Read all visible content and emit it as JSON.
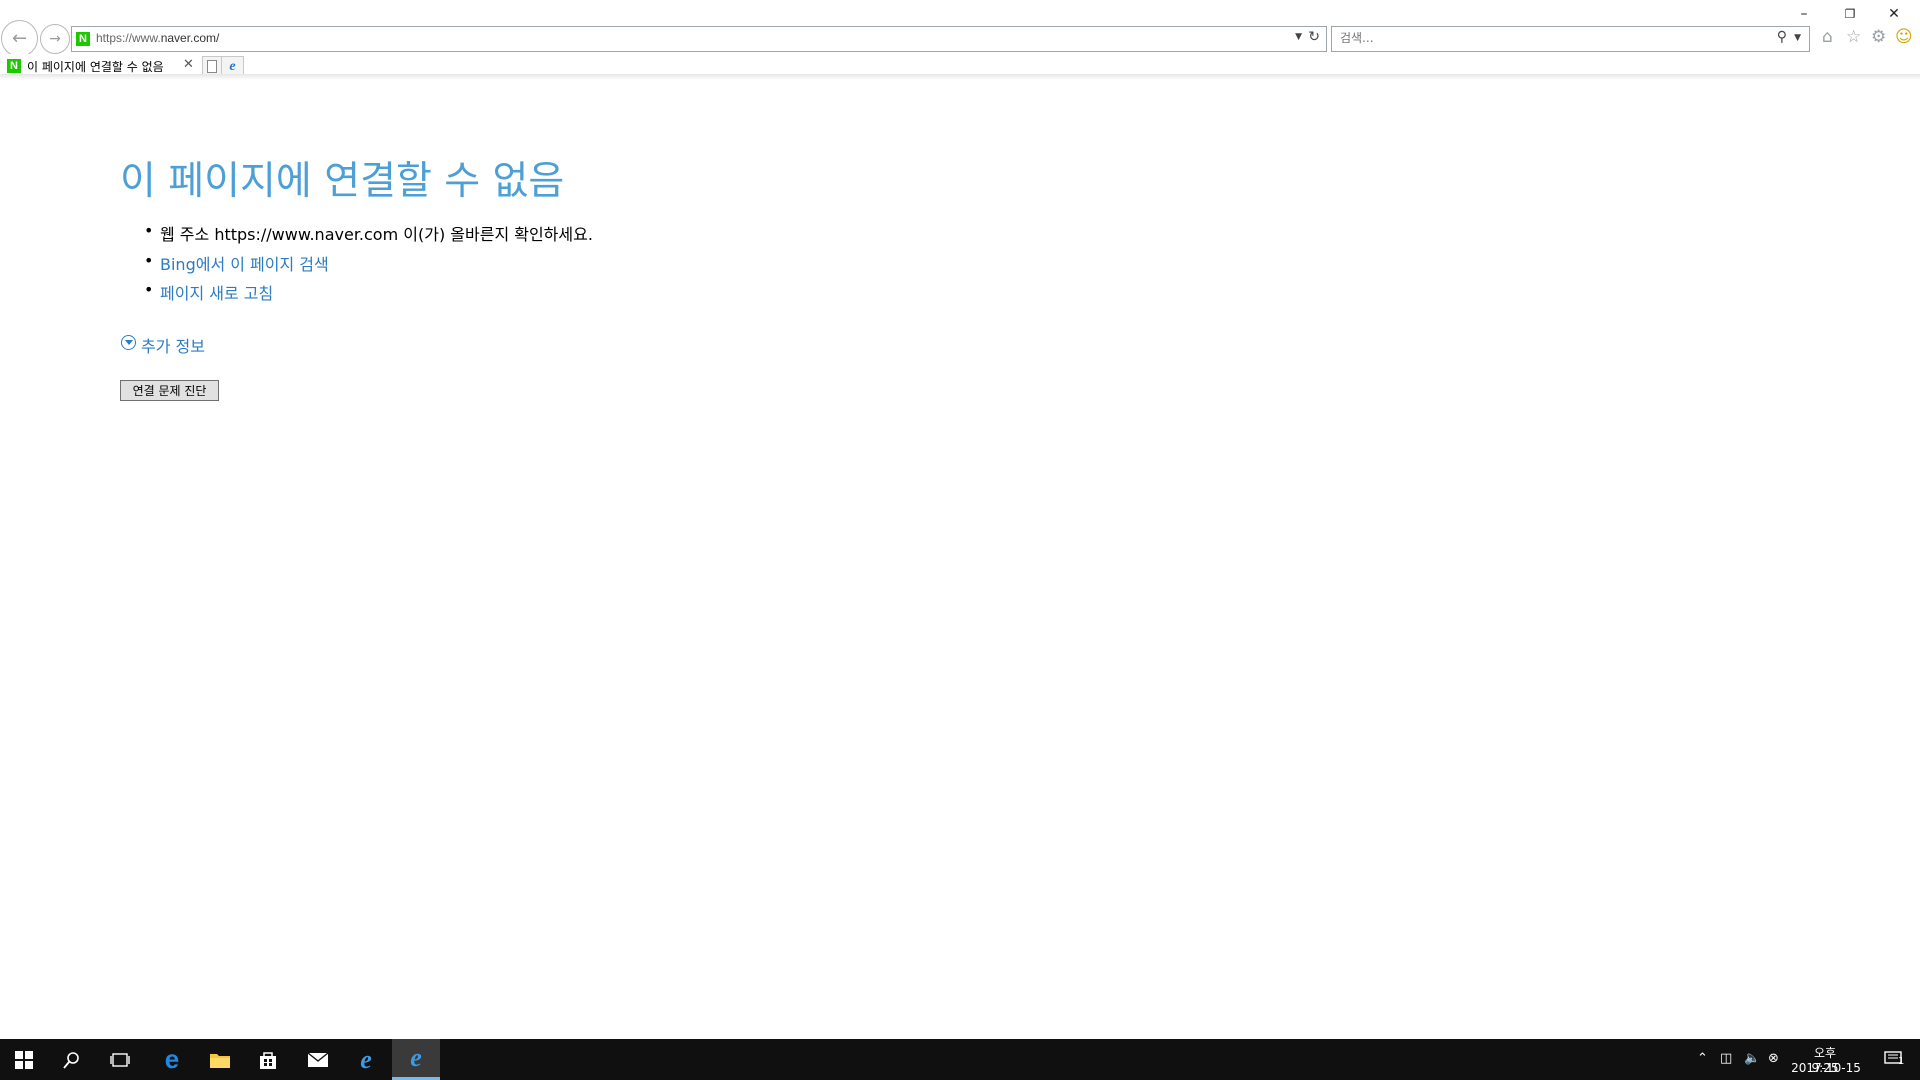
{
  "browser": {
    "url_prefix": "https://www.",
    "url_domain": "naver.com/",
    "search_placeholder": "검색...",
    "tab_title": "이 페이지에 연결할 수 없음",
    "favicon_letter": "N"
  },
  "content": {
    "title": "이 페이지에 연결할 수 없음",
    "bullet1_text": "웹 주소 https://www.naver.com 이(가) 올바른지 확인하세요.",
    "bullet2_link": "Bing에서 이 페이지 검색",
    "bullet3_link": "페이지 새로 고침",
    "more_info": "추가 정보",
    "diagnose_button": "연결 문제 진단"
  },
  "taskbar": {
    "clock_ampm_time": "오후 9:25",
    "clock_date": "2017-10-15",
    "notification_count": "1"
  },
  "colors": {
    "title_blue": "#4d9fd6",
    "link_blue": "#2c7cc4",
    "naver_green": "#1ec800",
    "taskbar_bg": "#101010"
  }
}
